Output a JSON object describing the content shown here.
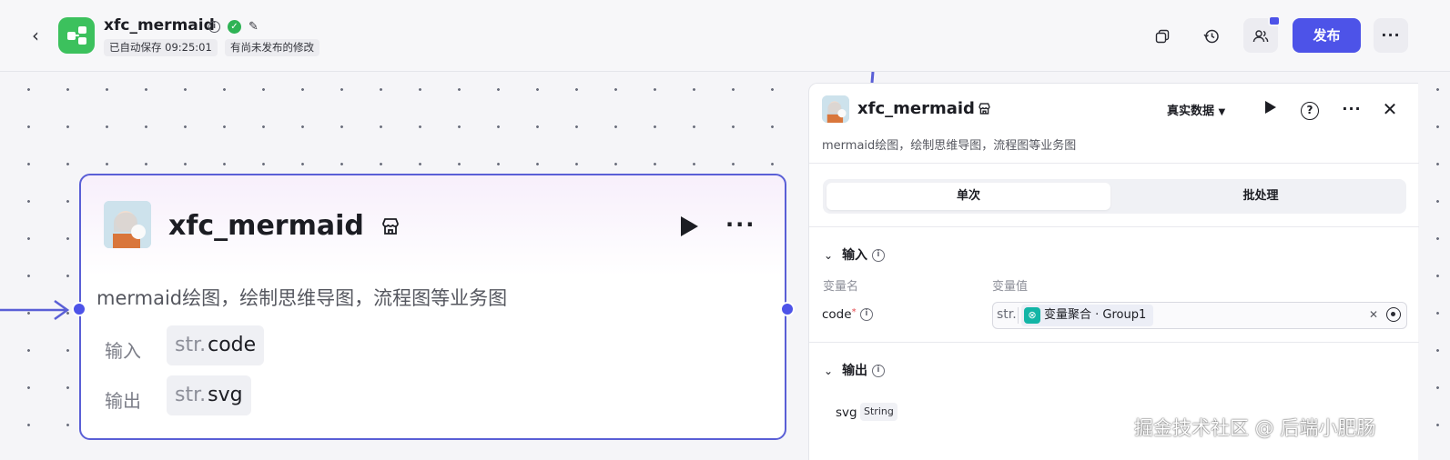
{
  "header": {
    "app_title": "xfc_mermaid",
    "autosave_text": "已自动保存 09:25:01",
    "unpublished_text": "有尚未发布的修改",
    "publish_label": "发布",
    "accent_color": "#4d53e8",
    "icons": [
      "back-arrow-icon",
      "app-workflow-icon",
      "info-icon",
      "verified-check-icon",
      "edit-icon",
      "copy-icon",
      "history-icon",
      "collaborators-icon",
      "more-icon"
    ]
  },
  "node": {
    "title": "xfc_mermaid",
    "description": "mermaid绘图，绘制思维导图，流程图等业务图",
    "input_label": "输入",
    "input_type": "str.",
    "input_name": "code",
    "output_label": "输出",
    "output_type": "str.",
    "output_name": "svg"
  },
  "panel": {
    "title": "xfc_mermaid",
    "description": "mermaid绘图，绘制思维导图，流程图等业务图",
    "data_mode": "真实数据",
    "tabs": [
      "单次",
      "批处理"
    ],
    "active_tab": "单次",
    "input_section": "输入",
    "col_name": "变量名",
    "col_value": "变量值",
    "param_name": "code",
    "param_required_mark": "*",
    "param_type": "str.",
    "param_value": "变量聚合 · Group1",
    "output_section": "输出",
    "output_name": "svg",
    "output_type": "String"
  },
  "watermark": "掘金技术社区 @ 后端小肥肠"
}
